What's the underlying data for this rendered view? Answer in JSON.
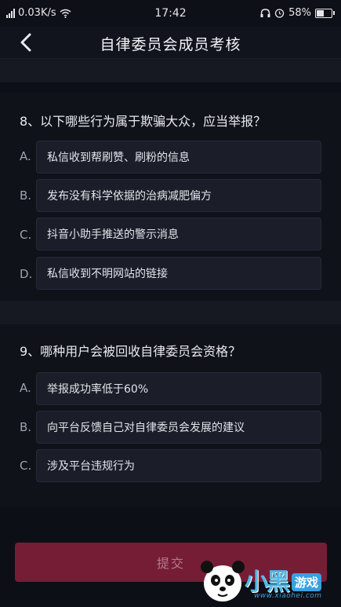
{
  "status_bar": {
    "network_speed": "0.03K/s",
    "time": "17:42",
    "battery_percent": "58%",
    "battery_level": 0.58,
    "icons": [
      "signal-icon",
      "wifi-icon",
      "headset-icon",
      "alarm-icon",
      "battery-icon"
    ]
  },
  "nav": {
    "back_icon": "chevron-left-icon",
    "title": "自律委员会成员考核"
  },
  "questions": [
    {
      "title": "8、以下哪些行为属于欺骗大众，应当举报？",
      "options": [
        {
          "letter": "A.",
          "text": "私信收到帮刷赞、刷粉的信息"
        },
        {
          "letter": "B.",
          "text": "发布没有科学依据的治病减肥偏方"
        },
        {
          "letter": "C.",
          "text": "抖音小助手推送的警示消息"
        },
        {
          "letter": "D.",
          "text": "私信收到不明网站的链接"
        }
      ]
    },
    {
      "title": "9、哪种用户会被回收自律委员会资格？",
      "options": [
        {
          "letter": "A.",
          "text": "举报成功率低于60%"
        },
        {
          "letter": "B.",
          "text": "向平台反馈自己对自律委员会发展的建议"
        },
        {
          "letter": "C.",
          "text": "涉及平台违规行为"
        }
      ]
    }
  ],
  "submit_label": "提交",
  "watermark": {
    "brand": "小黑",
    "badge": "游戏",
    "url": "www.xiaohei.com"
  },
  "colors": {
    "background": "#0d0f16",
    "option_box": "#1b1e29",
    "submit_button": "#761d36",
    "submit_text": "#b37b89",
    "watermark_blue": "#3aa0e0"
  }
}
